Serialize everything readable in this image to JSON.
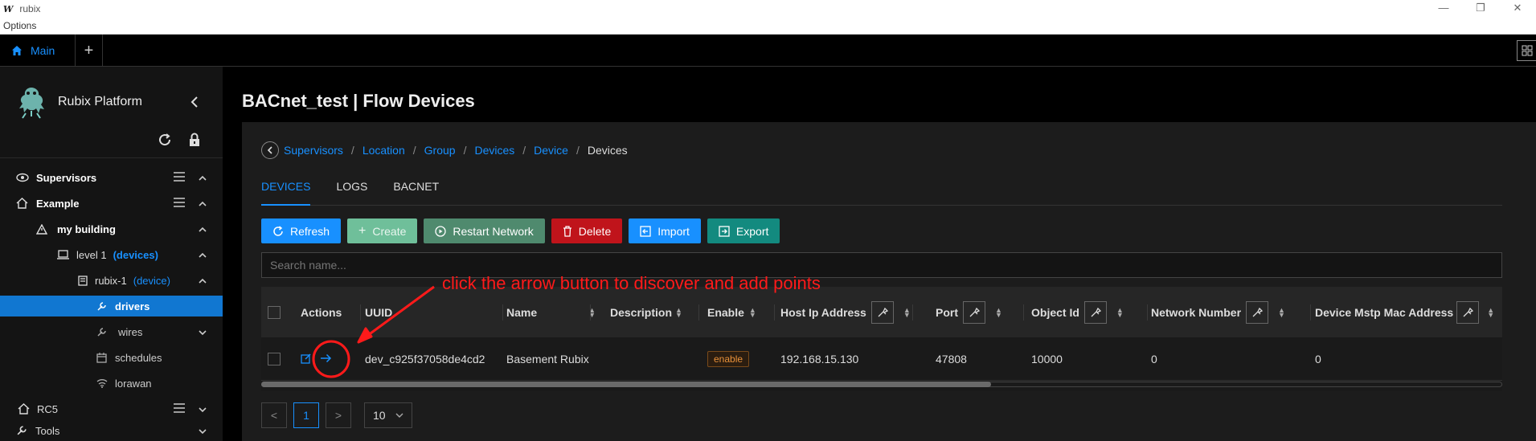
{
  "window": {
    "title": "rubix",
    "menu": "Options",
    "logo_glyph": "W"
  },
  "tabbar": {
    "main_tab": "Main",
    "add": "+"
  },
  "sidebar": {
    "brand": "Rubix Platform",
    "items": [
      {
        "label": "Supervisors",
        "tag": ""
      },
      {
        "label": "Example",
        "tag": ""
      },
      {
        "label": "my building",
        "tag": ""
      },
      {
        "label": "level 1",
        "tag": "(devices)"
      },
      {
        "label": "rubix-1",
        "tag": "(device)"
      },
      {
        "label": "drivers",
        "tag": ""
      },
      {
        "label": "wires",
        "tag": ""
      },
      {
        "label": "schedules",
        "tag": ""
      },
      {
        "label": "lorawan",
        "tag": ""
      },
      {
        "label": "RC5",
        "tag": ""
      },
      {
        "label": "Tools",
        "tag": ""
      }
    ]
  },
  "page": {
    "title": "BACnet_test | Flow Devices"
  },
  "breadcrumb": {
    "links": [
      "Supervisors",
      "Location",
      "Group",
      "Devices",
      "Device"
    ],
    "separator": "/",
    "current": "Devices"
  },
  "tabs": [
    "DEVICES",
    "LOGS",
    "BACNET"
  ],
  "toolbar": {
    "refresh": "Refresh",
    "create": "Create",
    "restart": "Restart Network",
    "delete": "Delete",
    "import": "Import",
    "export": "Export"
  },
  "search": {
    "placeholder": "Search name..."
  },
  "table": {
    "columns": [
      "Actions",
      "UUID",
      "Name",
      "Description",
      "Enable",
      "Host Ip Address",
      "Port",
      "Object Id",
      "Network Number",
      "Device Mstp Mac Address"
    ],
    "rows": [
      {
        "uuid": "dev_c925f37058de4cd2",
        "name": "Basement Rubix",
        "description": "",
        "enable": "enable",
        "host_ip": "192.168.15.130",
        "port": "47808",
        "object_id": "10000",
        "network_number": "0",
        "mstp_mac": "0"
      }
    ]
  },
  "pagination": {
    "prev": "<",
    "current": "1",
    "next": ">",
    "page_size": "10"
  },
  "annotation": {
    "text": "click the arrow button to discover and add points"
  },
  "colors": {
    "accent": "#1890ff",
    "danger": "#c0141b",
    "annotation": "#ff1a1a",
    "active_menu": "#1177d1"
  }
}
